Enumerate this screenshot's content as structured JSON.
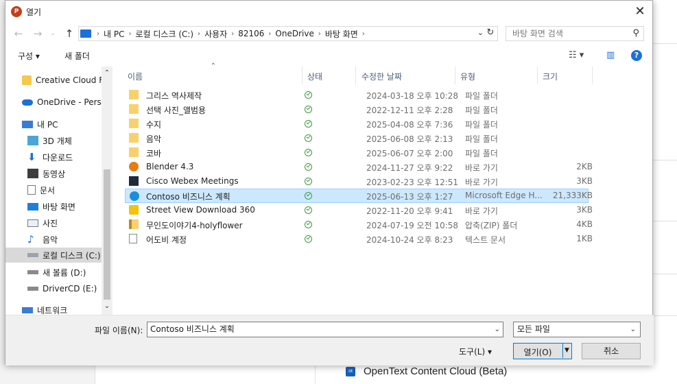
{
  "background": {
    "list_item": "OpenText Content Cloud (Beta)",
    "list_item_icon": "ot"
  },
  "dialog": {
    "title": "열기",
    "app_icon_letter": "P"
  },
  "address": {
    "crumbs": [
      "내 PC",
      "로컬 디스크 (C:)",
      "사용자",
      "82106",
      "OneDrive",
      "바탕 화면"
    ],
    "search_placeholder": "바탕 화면 검색"
  },
  "toolbar": {
    "organize": "구성 ▾",
    "new_folder": "새 폴더"
  },
  "sidebar": {
    "items": [
      {
        "label": "Creative Cloud Fil",
        "icon": "creative-cloud"
      },
      {
        "label": "OneDrive - Persor",
        "icon": "onedrive"
      },
      {
        "label": "내 PC",
        "icon": "pc"
      },
      {
        "label": "3D 개체",
        "icon": "3d"
      },
      {
        "label": "다운로드",
        "icon": "download"
      },
      {
        "label": "동영상",
        "icon": "video"
      },
      {
        "label": "문서",
        "icon": "document"
      },
      {
        "label": "바탕 화면",
        "icon": "desktop"
      },
      {
        "label": "사진",
        "icon": "picture"
      },
      {
        "label": "음악",
        "icon": "music"
      },
      {
        "label": "로컬 디스크 (C:)",
        "icon": "drive"
      },
      {
        "label": "새 볼륨 (D:)",
        "icon": "drive"
      },
      {
        "label": "DriverCD (E:)",
        "icon": "drive"
      },
      {
        "label": "네트워크",
        "icon": "network"
      }
    ]
  },
  "columns": {
    "name": "이름",
    "status": "상태",
    "modified": "수정한 날짜",
    "type": "유형",
    "size": "크기"
  },
  "files": [
    {
      "name": "그리스 역사제작",
      "date": "2024-03-18 오후 10:28",
      "type": "파일 폴더",
      "size": "",
      "icon": "folder"
    },
    {
      "name": "선택 사진_앨범용",
      "date": "2022-12-11 오후 2:28",
      "type": "파일 폴더",
      "size": "",
      "icon": "folder"
    },
    {
      "name": "수지",
      "date": "2025-04-08 오후 7:36",
      "type": "파일 폴더",
      "size": "",
      "icon": "folder"
    },
    {
      "name": "음악",
      "date": "2025-06-08 오후 2:13",
      "type": "파일 폴더",
      "size": "",
      "icon": "folder"
    },
    {
      "name": "코바",
      "date": "2025-06-07 오후 2:00",
      "type": "파일 폴더",
      "size": "",
      "icon": "folder"
    },
    {
      "name": "Blender 4.3",
      "date": "2024-11-27 오후 9:22",
      "type": "바로 가기",
      "size": "2KB",
      "icon": "blender"
    },
    {
      "name": "Cisco Webex Meetings",
      "date": "2023-02-23 오후 12:51",
      "type": "바로 가기",
      "size": "3KB",
      "icon": "webex"
    },
    {
      "name": "Contoso 비즈니스 계획",
      "date": "2025-06-13 오후 1:27",
      "type": "Microsoft Edge H...",
      "size": "21,333KB",
      "icon": "edge"
    },
    {
      "name": "Street View Download 360",
      "date": "2022-11-20 오후 9:41",
      "type": "바로 가기",
      "size": "3KB",
      "icon": "streetview"
    },
    {
      "name": "무인도이야기4-holyflower",
      "date": "2024-07-19 오전 10:58",
      "type": "압축(ZIP) 폴더",
      "size": "4KB",
      "icon": "zip"
    },
    {
      "name": "어도비 계정",
      "date": "2024-10-24 오후 8:23",
      "type": "텍스트 문서",
      "size": "1KB",
      "icon": "text"
    }
  ],
  "selected_file": "Contoso 비즈니스 계획",
  "bottom": {
    "filename_label": "파일 이름(N):",
    "filename_value": "Contoso 비즈니스 계획",
    "filetype": "모든 파일",
    "tools": "도구(L)   ▾",
    "open": "열기(O)",
    "cancel": "취소"
  }
}
